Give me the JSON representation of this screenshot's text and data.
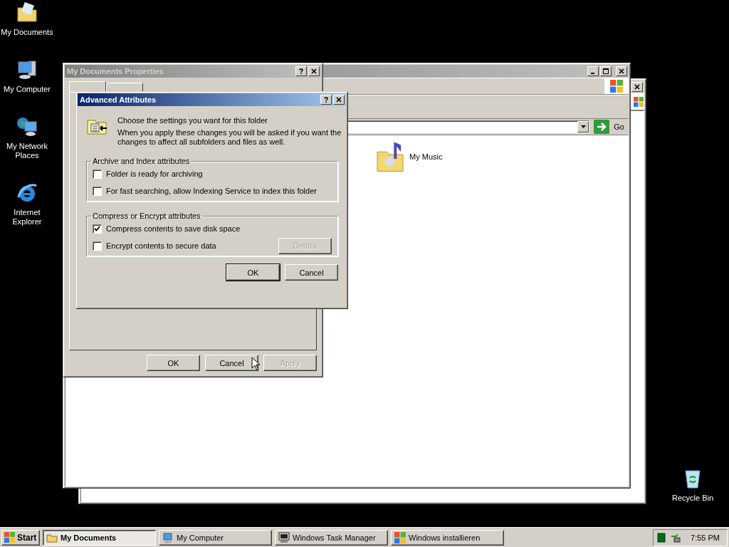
{
  "desktop_icons": [
    {
      "label": "My Documents",
      "kind": "documents"
    },
    {
      "label": "My Computer",
      "kind": "computer"
    },
    {
      "label": "My Network Places",
      "kind": "network"
    },
    {
      "label": "Internet Explorer",
      "kind": "browser"
    }
  ],
  "recycle_bin": {
    "label": "Recycle Bin"
  },
  "explorer_window": {
    "active": false,
    "go_button": "Go",
    "items": [
      {
        "label": "My Music",
        "kind": "music"
      }
    ]
  },
  "properties_dialog": {
    "title": "My Documents Properties",
    "active": false,
    "buttons": [
      {
        "label": "OK",
        "disabled": false
      },
      {
        "label": "Cancel",
        "disabled": false
      },
      {
        "label": "Apply",
        "disabled": true
      }
    ]
  },
  "advanced_dialog": {
    "title": "Advanced Attributes",
    "active": true,
    "heading": "Choose the settings you want for this folder",
    "description": "When you apply these changes you will be asked if you want the changes to affect all subfolders and files as well.",
    "groups": [
      {
        "title": "Archive and Index attributes",
        "options": [
          {
            "label": "Folder is ready for archiving",
            "checked": false
          },
          {
            "label": "For fast searching, allow Indexing Service to index this folder",
            "checked": false
          }
        ]
      },
      {
        "title": "Compress or Encrypt attributes",
        "options": [
          {
            "label": "Compress contents to save disk space",
            "checked": true
          },
          {
            "label": "Encrypt contents to secure data",
            "checked": false
          }
        ],
        "details_button": {
          "label": "Details",
          "disabled": true
        }
      }
    ],
    "buttons": [
      {
        "label": "OK",
        "default": true
      },
      {
        "label": "Cancel",
        "default": false
      }
    ]
  },
  "taskbar": {
    "start": "Start",
    "tasks": [
      {
        "label": "My Documents",
        "selected": true,
        "kind": "folder"
      },
      {
        "label": "My Computer",
        "selected": false,
        "kind": "computer"
      },
      {
        "label": "Windows Task Manager",
        "selected": false,
        "kind": "taskmgr"
      },
      {
        "label": "Windows installieren",
        "selected": false,
        "kind": "windows"
      }
    ],
    "clock": "7:55 PM"
  }
}
